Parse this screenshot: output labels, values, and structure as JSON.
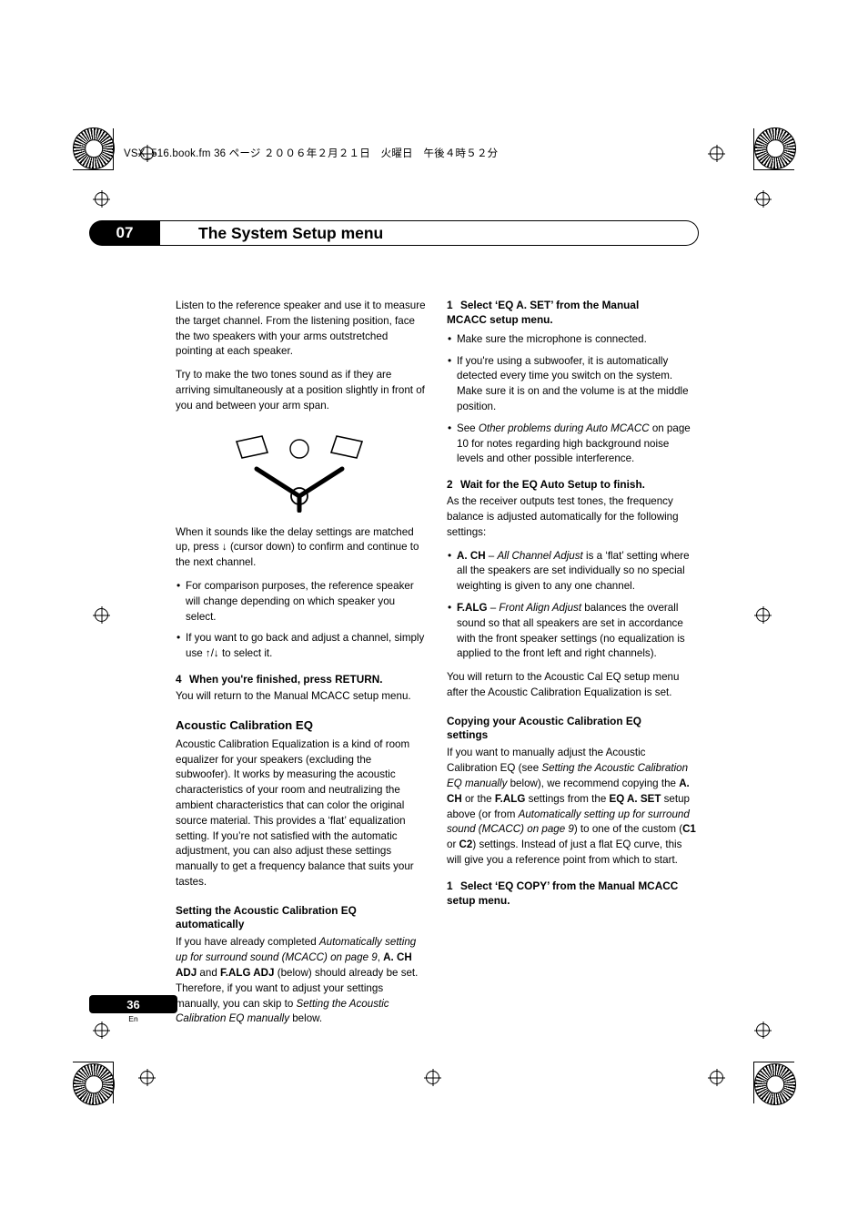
{
  "header": {
    "slug": "VSX_516.book.fm  36 ページ  ２００６年２月２１日　火曜日　午後４時５２分"
  },
  "chapter": {
    "number": "07",
    "title": "The System Setup menu"
  },
  "left_column": {
    "para1": "Listen to the reference speaker and use it to measure the target channel. From the listening position, face the two speakers with your arms outstretched pointing at each speaker.",
    "para2": "Try to make the two tones sound as if they are arriving simultaneously at a position slightly in front of you and between your arm span.",
    "para3_a": "When it sounds like the delay settings are matched up, press ",
    "para3_b": " (cursor down) to confirm and continue to the next channel.",
    "bullets": [
      "For comparison purposes, the reference speaker will change depending on which speaker you select.",
      "If you want to go back and adjust a channel, simply use ↑/↓ to select it."
    ],
    "step4_num": "4",
    "step4_label": "When you're finished, press RETURN.",
    "step4_body": "You will return to the Manual MCACC setup menu.",
    "heading_acoustic": "Acoustic Calibration EQ",
    "acoustic_body": "Acoustic Calibration Equalization is a kind of room equalizer for your speakers (excluding the subwoofer). It works by measuring the acoustic characteristics of your room and neutralizing the ambient characteristics that can color the original source material. This provides a ‘flat’ equalization setting. If you’re not satisfied with the automatic adjustment, you can also adjust these settings manually to get a frequency balance that suits your tastes.",
    "heading_setting_auto_l1": "Setting the Acoustic Calibration EQ",
    "heading_setting_auto_l2": "automatically",
    "setting_auto": {
      "t1": "If you have already completed ",
      "i1": "Automatically setting up for surround sound (MCACC) on page 9",
      "t2": ", ",
      "b1": "A. CH ADJ",
      "t3": " and ",
      "b2": "F.ALG ADJ",
      "t4": " (below) should already be set. Therefore, if you want to adjust your settings manually, you can skip to ",
      "i2": "Setting the Acoustic Calibration EQ manually",
      "t5": " below."
    }
  },
  "right_column": {
    "step1_num": "1",
    "step1_label_l1": "Select ‘EQ A. SET’ from the Manual",
    "step1_label_l2": "MCACC setup menu.",
    "step1_bullets": [
      "Make sure the microphone is connected.",
      "If you're using a subwoofer, it is automatically detected every time you switch on the system. Make sure it is on and the volume is at the middle position."
    ],
    "step1_bullet3": {
      "t1": "See ",
      "i1": "Other problems during Auto MCACC",
      "t2": " on page 10 for notes regarding high background noise levels and other possible interference."
    },
    "step2_num": "2",
    "step2_label": "Wait for the EQ Auto Setup to finish.",
    "step2_body": "As the receiver outputs test tones, the frequency balance is adjusted automatically for the following settings:",
    "step2_bullet1": {
      "b1": "A. CH",
      "t1": " – ",
      "i1": "All Channel Adjust",
      "t2": " is a ‘flat’ setting where all the speakers are set individually so no special weighting is given to any one channel."
    },
    "step2_bullet2": {
      "b1": "F.ALG",
      "t1": " – ",
      "i1": "Front Align Adjust",
      "t2": " balances the overall sound so that all speakers are set in accordance with the front speaker settings (no equalization is applied to the front left and right channels)."
    },
    "after_bullets": "You will return to the Acoustic Cal EQ setup menu after the Acoustic Calibration Equalization is set.",
    "heading_copy_l1": "Copying your Acoustic Calibration EQ",
    "heading_copy_l2": "settings",
    "copy_body": {
      "t1": "If you want to manually adjust the Acoustic Calibration EQ (see ",
      "i1": "Setting the Acoustic Calibration EQ manually",
      "t2": " below), we recommend copying the ",
      "b1": "A. CH",
      "t3": " or the ",
      "b2": "F.ALG",
      "t4": " settings from the ",
      "b3": "EQ A. SET",
      "t5": " setup above (or from ",
      "i2": "Automatically setting up for surround sound (MCACC) on page 9",
      "t6": ") to one of the custom (",
      "b4": "C1",
      "t7": " or ",
      "b5": "C2",
      "t8": ") settings. Instead of just a flat EQ curve, this will give you a reference point from which to start."
    },
    "step_copy_num": "1",
    "step_copy_label_l1": "Select ‘EQ COPY’ from the Manual MCACC",
    "step_copy_label_l2": "setup menu."
  },
  "footer": {
    "page_number": "36",
    "language": "En"
  },
  "colors": {
    "ink": "#000000",
    "paper": "#ffffff"
  }
}
